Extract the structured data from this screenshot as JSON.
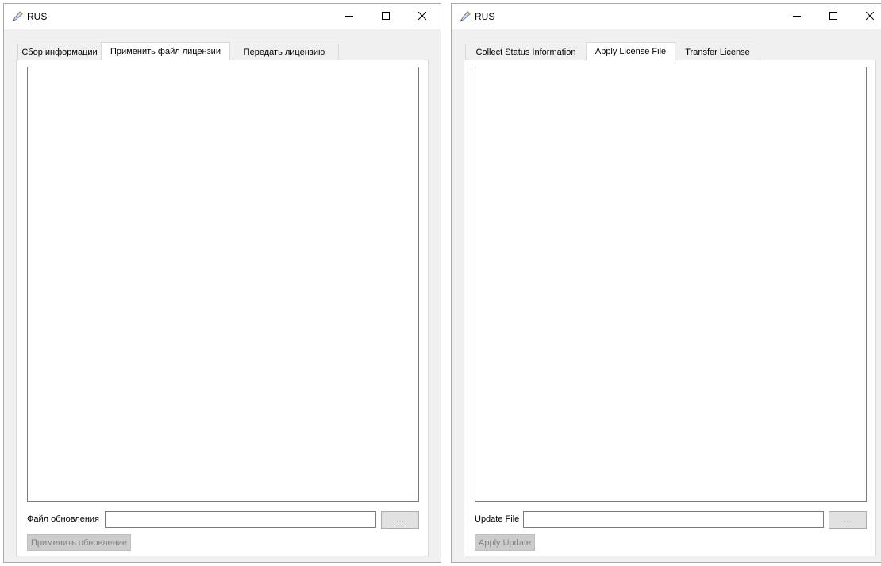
{
  "windows": {
    "left": {
      "title": "RUS",
      "tabs": [
        "Сбор информации",
        "Применить файл лицензии",
        "Передать лицензию"
      ],
      "active_tab_index": 1,
      "update_file_label": "Файл обновления",
      "update_file_value": "",
      "browse_label": "...",
      "apply_label": "Применить обновление"
    },
    "right": {
      "title": "RUS",
      "tabs": [
        "Collect Status Information",
        "Apply License File",
        "Transfer License"
      ],
      "active_tab_index": 1,
      "update_file_label": "Update File",
      "update_file_value": "",
      "browse_label": "...",
      "apply_label": "Apply Update"
    }
  },
  "icons": {
    "app": "pen-nib-icon",
    "minimize": "minimize-icon",
    "maximize": "maximize-icon",
    "close": "close-icon"
  }
}
